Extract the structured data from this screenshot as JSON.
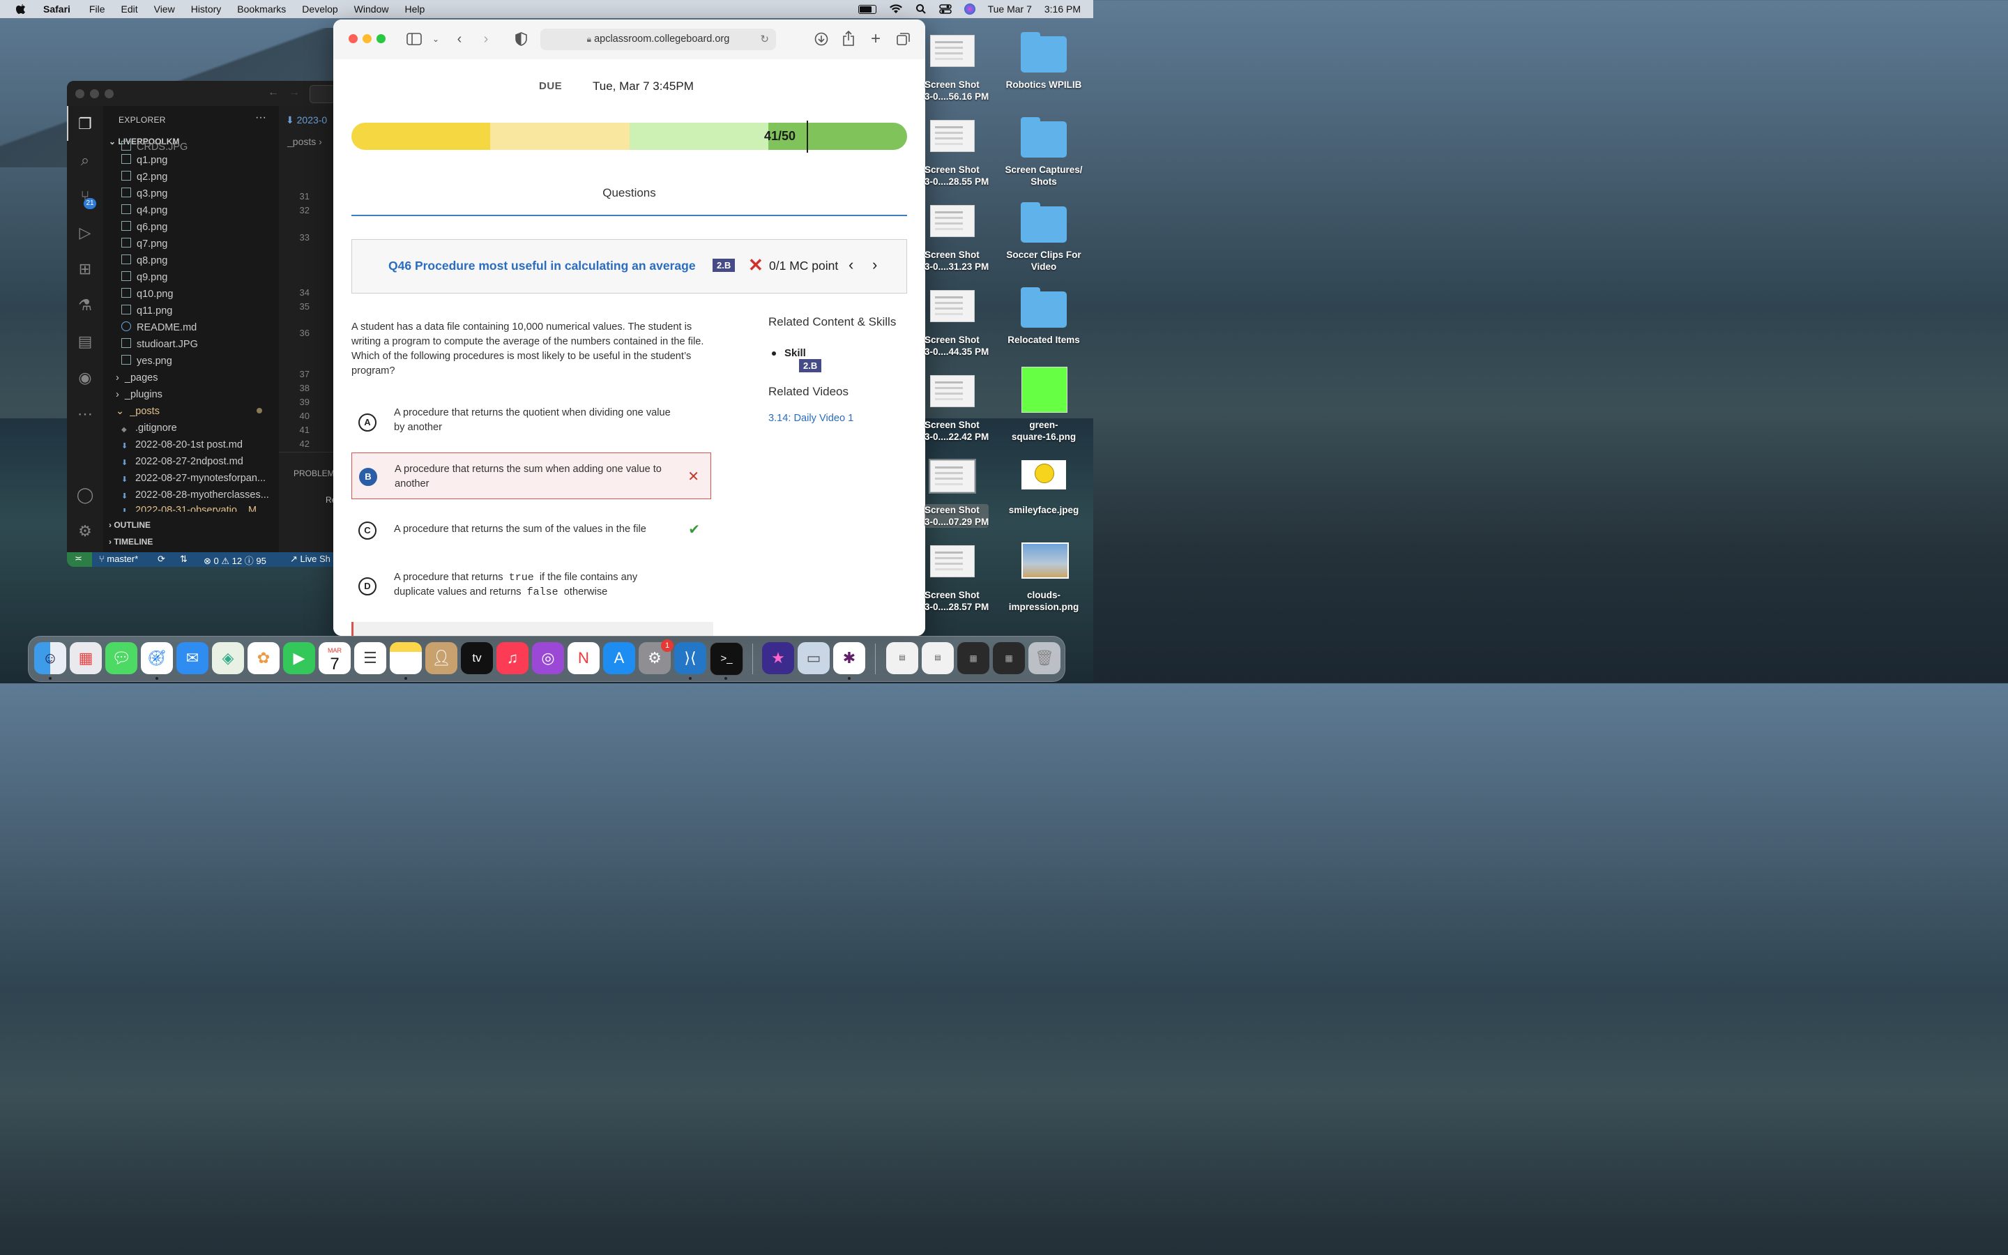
{
  "menubar": {
    "app_name": "Safari",
    "items": [
      "File",
      "Edit",
      "View",
      "History",
      "Bookmarks",
      "Develop",
      "Window",
      "Help"
    ],
    "date": "Tue Mar 7",
    "time": "3:16 PM"
  },
  "vscode": {
    "explorer_title": "EXPLORER",
    "more": "···",
    "project": "LIVERPOOLKM",
    "partial_top_file": "CRDS.JPG",
    "files": [
      "q1.png",
      "q2.png",
      "q3.png",
      "q4.png",
      "q6.png",
      "q7.png",
      "q8.png",
      "q9.png",
      "q10.png",
      "q11.png",
      "README.md",
      "studioart.JPG",
      "yes.png"
    ],
    "folders": [
      "_pages",
      "_plugins",
      "_posts"
    ],
    "posts": [
      ".gitignore",
      "2022-08-20-1st post.md",
      "2022-08-27-2ndpost.md",
      "2022-08-27-mynotesforpan...",
      "2022-08-28-myotherclasses...",
      "2022-08-31-observatio..."
    ],
    "partial_post_suffix": "M",
    "outline": "OUTLINE",
    "timeline": "TIMELINE",
    "editor_tab": "2023-0",
    "breadcrumb": "_posts",
    "line_numbers": [
      "31",
      "32",
      "33",
      "34",
      "35",
      "36",
      "37",
      "38",
      "39",
      "40",
      "41",
      "42"
    ],
    "panel_tab": "PROBLEM",
    "panel_text": "Re",
    "scm_badge": "21",
    "status": {
      "branch": "master*",
      "errors": "0",
      "warnings": "12",
      "info": "95",
      "live_share": "Live Sh"
    }
  },
  "safari": {
    "url": "apclassroom.collegeboard.org",
    "due_label": "DUE",
    "due_value": "Tue, Mar 7 3:45PM",
    "score": "41/50",
    "score_fraction": 0.82,
    "progress_colors": [
      "#f5d742",
      "#f9e7a0",
      "#cdf0b4",
      "#7fc35a"
    ],
    "tab_label": "Questions",
    "question_title": "Q46 Procedure most useful in calculating an average",
    "skill_code": "2.B",
    "points": "0/1 MC point",
    "stem": "A student has a data file containing 10,000 numerical values. The student is writing a program to compute the average of the numbers contained in the file. Which of the following procedures is most likely to be useful in the student’s program?",
    "options": [
      {
        "letter": "A",
        "text": "A procedure that returns the quotient when dividing one value by another"
      },
      {
        "letter": "B",
        "text": "A procedure that returns the sum when adding one value to another"
      },
      {
        "letter": "C",
        "text": "A procedure that returns the sum of the values in the file"
      },
      {
        "letter": "D",
        "text_before": "A procedure that returns",
        "code1": "true",
        "text_mid": "if the file contains any duplicate values and returns",
        "code2": "false",
        "text_after": "otherwise"
      }
    ],
    "related_heading": "Related Content & Skills",
    "skill_label": "Skill",
    "videos_heading": "Related Videos",
    "video_link": "3.14: Daily Video 1"
  },
  "desktop": {
    "screenshots": [
      "Screen Shot\n3-0....56.16 PM",
      "Screen Shot\n3-0....28.55 PM",
      "Screen Shot\n3-0....31.23 PM",
      "Screen Shot\n3-0....44.35 PM",
      "Screen Shot\n3-0....22.42 PM",
      "Screen Shot\n3-0....07.29 PM",
      "Screen Shot\n3-0....28.57 PM"
    ],
    "folders": [
      "Robotics WPILIB",
      "Screen Captures/\nShots",
      "Soccer Clips For\nVideo",
      "Relocated Items"
    ],
    "files": [
      "green-\nsquare-16.png",
      "smileyface.jpeg",
      "clouds-\nimpression.png"
    ]
  },
  "dock": {
    "calendar_month": "MAR",
    "calendar_day": "7",
    "settings_badge": "1",
    "tv_label": "tv"
  }
}
